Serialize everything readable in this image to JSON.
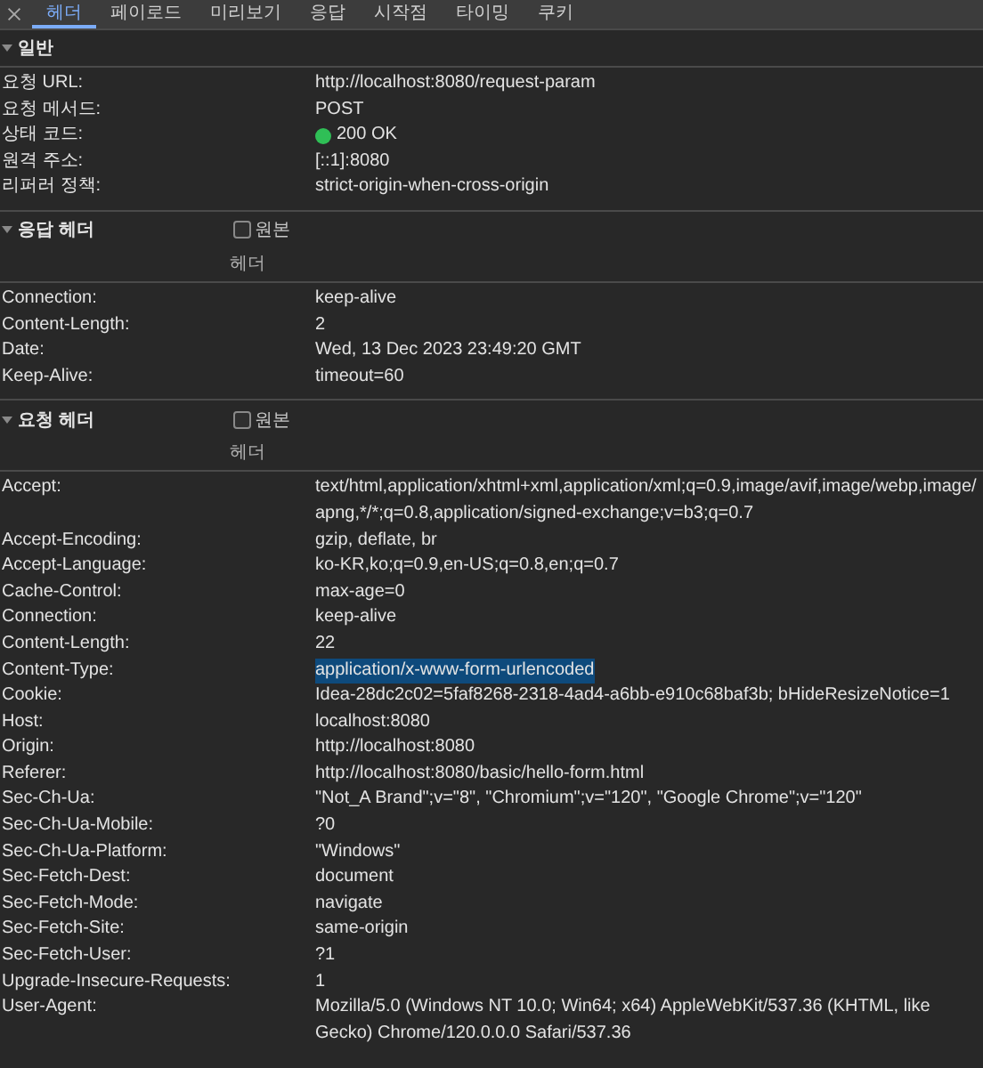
{
  "tabs": [
    {
      "label": "헤더",
      "selected": true
    },
    {
      "label": "페이로드",
      "selected": false
    },
    {
      "label": "미리보기",
      "selected": false
    },
    {
      "label": "응답",
      "selected": false
    },
    {
      "label": "시작점",
      "selected": false
    },
    {
      "label": "타이밍",
      "selected": false
    },
    {
      "label": "쿠키",
      "selected": false
    }
  ],
  "general": {
    "title": "일반",
    "expanded": true,
    "rows": [
      {
        "name": "요청 URL:",
        "value": "http://localhost:8080/request-param",
        "kind": "text"
      },
      {
        "name": "요청 메서드:",
        "value": "POST",
        "kind": "text"
      },
      {
        "name": "상태 코드:",
        "value": "200 OK",
        "kind": "status",
        "color": "#2fbf56"
      },
      {
        "name": "원격 주소:",
        "value": "[::1]:8080",
        "kind": "text"
      },
      {
        "name": "리퍼러 정책:",
        "value": "strict-origin-when-cross-origin",
        "kind": "text"
      }
    ]
  },
  "response_headers": {
    "title": "응답 헤더",
    "expanded": true,
    "raw_label": "원본",
    "raw_checked": false,
    "column_label": "헤더",
    "rows": [
      {
        "name": "Connection:",
        "value": "keep-alive"
      },
      {
        "name": "Content-Length:",
        "value": "2"
      },
      {
        "name": "Date:",
        "value": "Wed, 13 Dec 2023 23:49:20 GMT"
      },
      {
        "name": "Keep-Alive:",
        "value": "timeout=60"
      }
    ]
  },
  "request_headers": {
    "title": "요청 헤더",
    "expanded": true,
    "raw_label": "원본",
    "raw_checked": false,
    "column_label": "헤더",
    "rows": [
      {
        "name": "Accept:",
        "value": "text/html,application/xhtml+xml,application/xml;q=0.9,image/avif,image/webp,image/apng,*/*;q=0.8,application/signed-exchange;v=b3;q=0.7",
        "selected": false
      },
      {
        "name": "Accept-Encoding:",
        "value": "gzip, deflate, br",
        "selected": false
      },
      {
        "name": "Accept-Language:",
        "value": "ko-KR,ko;q=0.9,en-US;q=0.8,en;q=0.7",
        "selected": false
      },
      {
        "name": "Cache-Control:",
        "value": "max-age=0",
        "selected": false
      },
      {
        "name": "Connection:",
        "value": "keep-alive",
        "selected": false
      },
      {
        "name": "Content-Length:",
        "value": "22",
        "selected": false
      },
      {
        "name": "Content-Type:",
        "value": "application/x-www-form-urlencoded",
        "selected": true
      },
      {
        "name": "Cookie:",
        "value": "Idea-28dc2c02=5faf8268-2318-4ad4-a6bb-e910c68baf3b; bHideResizeNotice=1",
        "selected": false
      },
      {
        "name": "Host:",
        "value": "localhost:8080",
        "selected": false
      },
      {
        "name": "Origin:",
        "value": "http://localhost:8080",
        "selected": false
      },
      {
        "name": "Referer:",
        "value": "http://localhost:8080/basic/hello-form.html",
        "selected": false
      },
      {
        "name": "Sec-Ch-Ua:",
        "value": "\"Not_A Brand\";v=\"8\", \"Chromium\";v=\"120\", \"Google Chrome\";v=\"120\"",
        "selected": false
      },
      {
        "name": "Sec-Ch-Ua-Mobile:",
        "value": "?0",
        "selected": false
      },
      {
        "name": "Sec-Ch-Ua-Platform:",
        "value": "\"Windows\"",
        "selected": false
      },
      {
        "name": "Sec-Fetch-Dest:",
        "value": "document",
        "selected": false
      },
      {
        "name": "Sec-Fetch-Mode:",
        "value": "navigate",
        "selected": false
      },
      {
        "name": "Sec-Fetch-Site:",
        "value": "same-origin",
        "selected": false
      },
      {
        "name": "Sec-Fetch-User:",
        "value": "?1",
        "selected": false
      },
      {
        "name": "Upgrade-Insecure-Requests:",
        "value": "1",
        "selected": false
      },
      {
        "name": "User-Agent:",
        "value": "Mozilla/5.0 (Windows NT 10.0; Win64; x64) AppleWebKit/537.36 (KHTML, like Gecko) Chrome/120.0.0.0 Safari/537.36",
        "selected": false
      }
    ]
  }
}
